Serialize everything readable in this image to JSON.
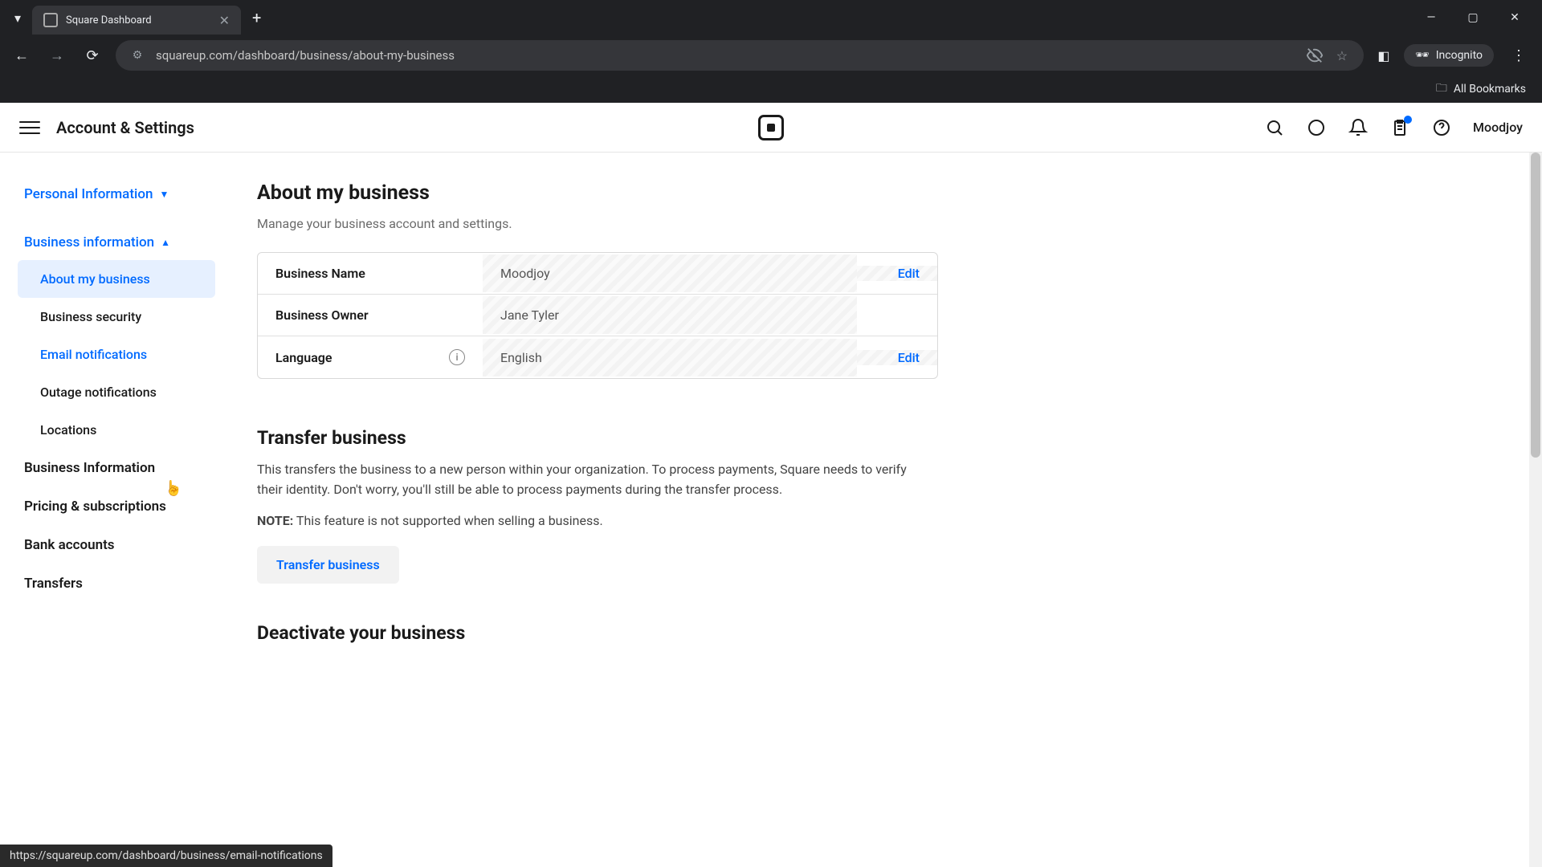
{
  "browser": {
    "tab_title": "Square Dashboard",
    "url": "squareup.com/dashboard/business/about-my-business",
    "incognito_label": "Incognito",
    "bookmarks_label": "All Bookmarks"
  },
  "header": {
    "title": "Account & Settings",
    "user": "Moodjoy"
  },
  "sidebar": {
    "personal": "Personal Information",
    "business": "Business information",
    "sub": {
      "about": "About my business",
      "security": "Business security",
      "email": "Email notifications",
      "outage": "Outage notifications",
      "locations": "Locations"
    },
    "biz_info": "Business Information",
    "pricing": "Pricing & subscriptions",
    "bank": "Bank accounts",
    "transfers": "Transfers"
  },
  "main": {
    "title": "About my business",
    "subtitle": "Manage your business account and settings.",
    "rows": {
      "name_label": "Business Name",
      "name_value": "Moodjoy",
      "owner_label": "Business Owner",
      "owner_value": "Jane Tyler",
      "lang_label": "Language",
      "lang_value": "English"
    },
    "edit": "Edit",
    "transfer_title": "Transfer business",
    "transfer_body": "This transfers the business to a new person within your organization. To process payments, Square needs to verify their identity. Don't worry, you'll still be able to process payments during the transfer process.",
    "note_label": "NOTE:",
    "note_text": " This feature is not supported when selling a business.",
    "transfer_btn": "Transfer business",
    "deactivate_title": "Deactivate your business"
  },
  "status_url": "https://squareup.com/dashboard/business/email-notifications"
}
